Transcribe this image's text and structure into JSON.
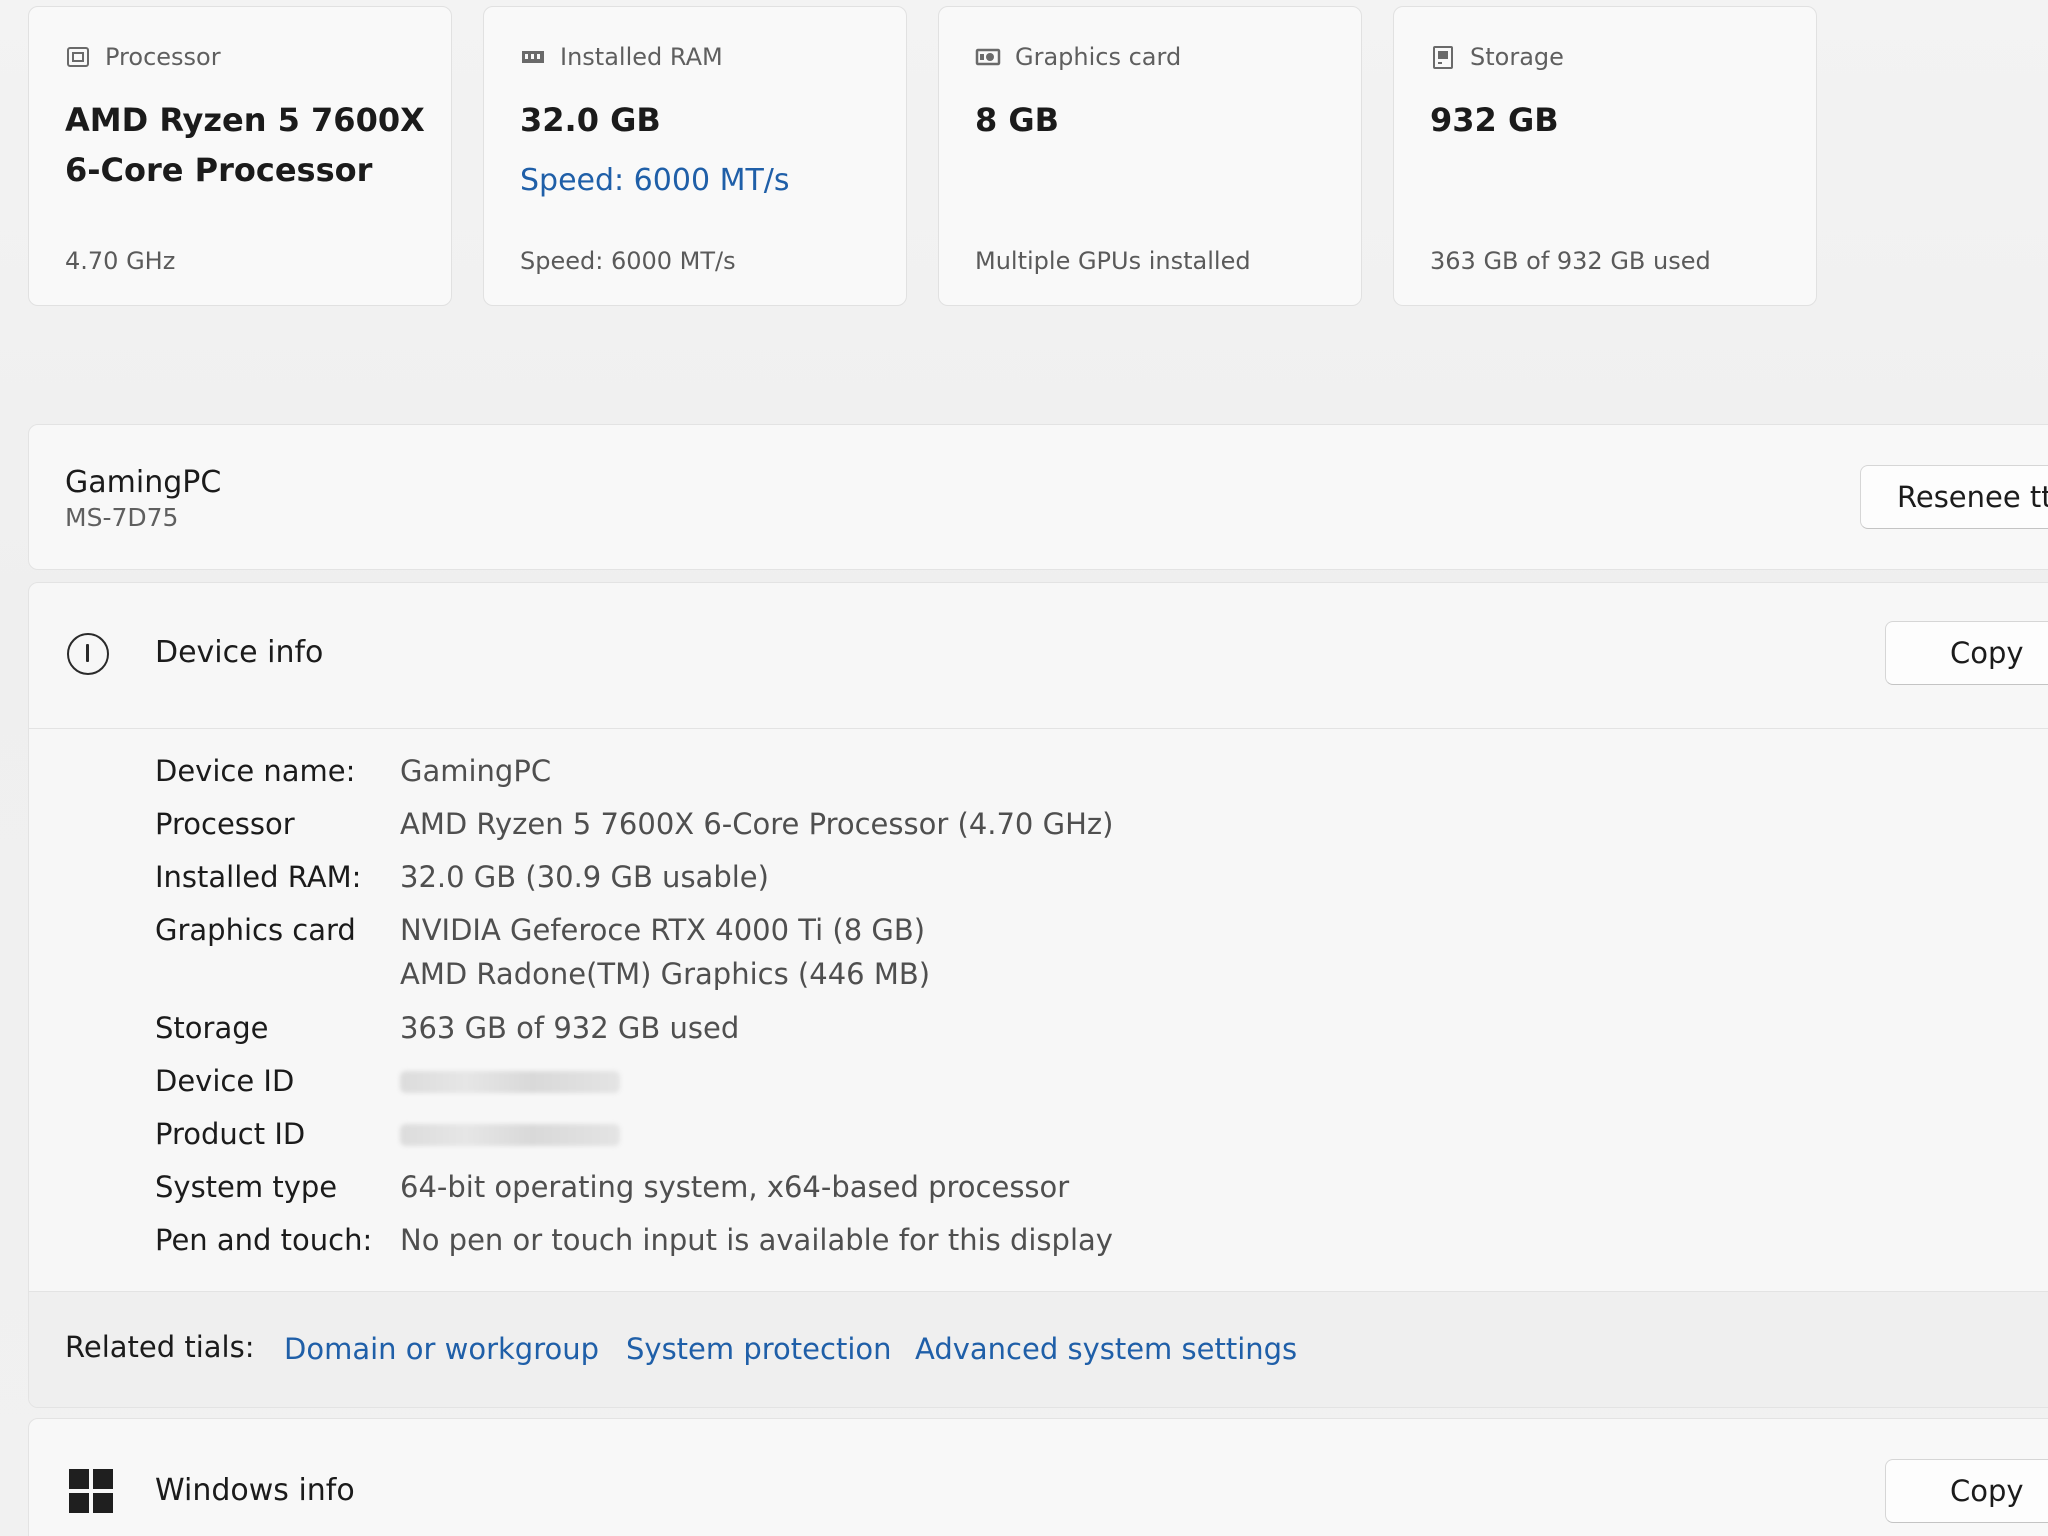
{
  "cards": [
    {
      "icon": "processor-icon",
      "title": "Processor",
      "value": "AMD Ryzen 5 7600X 6-Core Processor",
      "link": "",
      "footer": "4.70 GHz"
    },
    {
      "icon": "ram-icon",
      "title": "Installed RAM",
      "value": "32.0 GB",
      "link": "Speed: 6000 MT/s",
      "footer": "Speed: 6000 MT/s"
    },
    {
      "icon": "graphics-card-icon",
      "title": "Graphics card",
      "value": "8 GB",
      "link": "",
      "footer": "Multiple GPUs installed"
    },
    {
      "icon": "storage-icon",
      "title": "Storage",
      "value": "932 GB",
      "link": "",
      "footer": "363 GB of 932 GB used"
    }
  ],
  "device": {
    "name": "GamingPC",
    "model": "MS-7D75",
    "rename_label": "Resenee ttis"
  },
  "device_info": {
    "title": "Device info",
    "copy_label": "Copy",
    "rows": [
      {
        "label": "Device name:",
        "value": "GamingPC"
      },
      {
        "label": "Processor",
        "value": "AMD Ryzen 5 7600X 6-Core Processor (4.70 GHz)"
      },
      {
        "label": "Installed RAM:",
        "value": "32.0 GB (30.9 GB usable)"
      },
      {
        "label": "Graphics card",
        "value": "NVIDIA Geferoce RTX 4000 Ti (8 GB)",
        "value2": "AMD Radone(TM) Graphics (446 MB)"
      },
      {
        "label": "Storage",
        "value": "363 GB of 932 GB used"
      },
      {
        "label": "Device ID",
        "value": ""
      },
      {
        "label": "Product ID",
        "value": ""
      },
      {
        "label": "System type",
        "value": "64-bit operating system, x64-based processor"
      },
      {
        "label": "Pen and touch:",
        "value": "No pen or touch input is available for this display"
      }
    ],
    "related_label": "Related tials:",
    "related_links": [
      "Domain or workgroup",
      "System protection",
      "Advanced system settings"
    ]
  },
  "windows_info": {
    "title": "Windows info",
    "copy_label": "Copy"
  },
  "colors": {
    "accent_link": "#1f5fa8",
    "background": "#f0f0f0",
    "card": "#f9f9f9"
  }
}
